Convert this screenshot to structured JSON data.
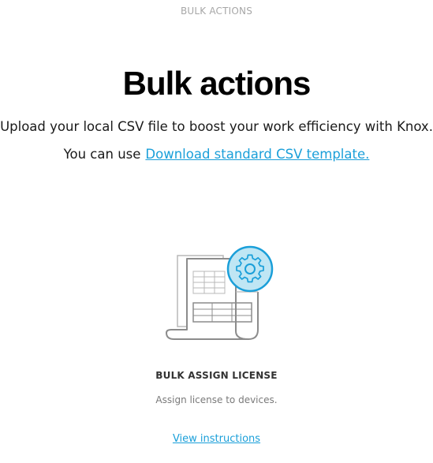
{
  "header": {
    "section_label": "BULK ACTIONS"
  },
  "main": {
    "title": "Bulk actions",
    "subtitle": "Upload your local CSV file to boost your work efficiency with Knox.",
    "template_prefix": "You can use",
    "template_link": "Download standard CSV template."
  },
  "card": {
    "icon": "csv-document-gear-icon",
    "title": "BULK ASSIGN LICENSE",
    "description": "Assign license to devices.",
    "link": "View instructions"
  },
  "colors": {
    "link": "#1a9fd9",
    "gear_fill": "#bfe6f4",
    "gear_stroke": "#1a9fd9"
  }
}
